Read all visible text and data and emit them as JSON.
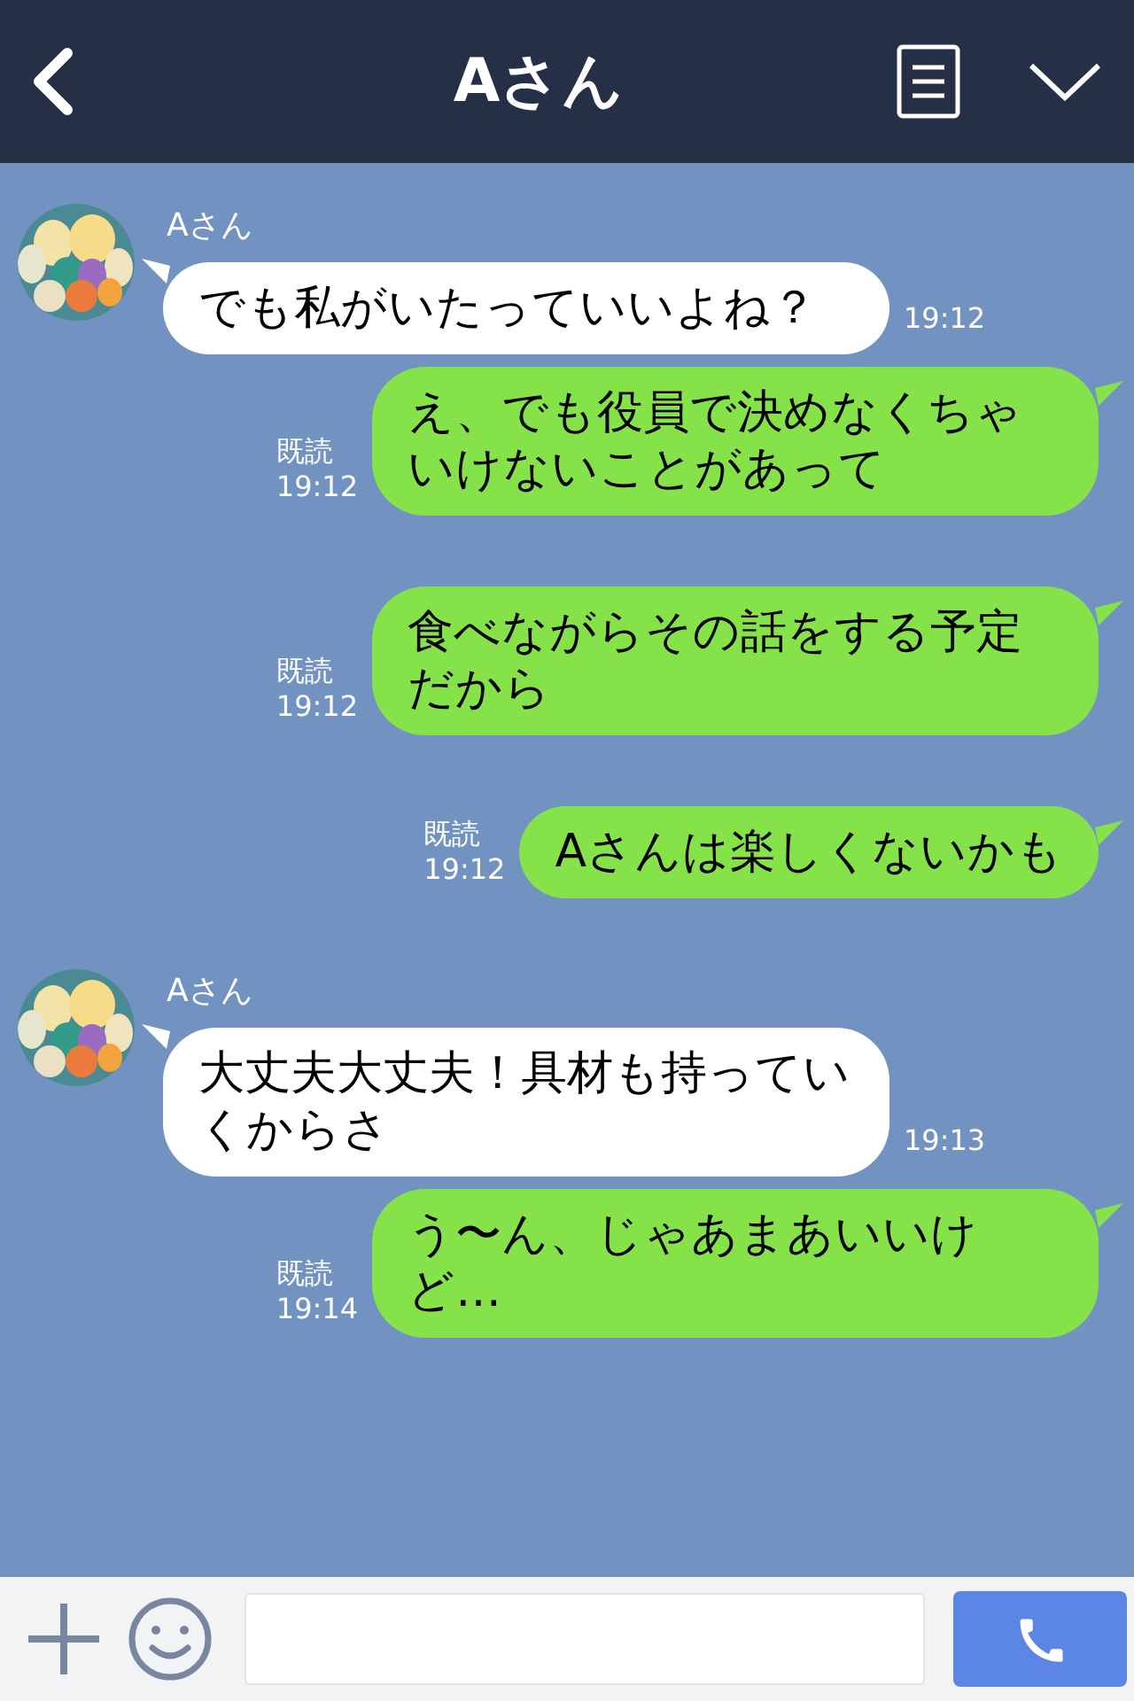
{
  "header": {
    "title": "Aさん"
  },
  "messages": [
    {
      "kind": "received",
      "sender": "Aさん",
      "text": "でも私がいたっていいよね？",
      "time": "19:12"
    },
    {
      "kind": "sent",
      "read": "既読",
      "text": "え、でも役員で決めなくちゃいけないことがあって",
      "time": "19:12"
    },
    {
      "kind": "sent",
      "read": "既読",
      "text": "食べながらその話をする予定だから",
      "time": "19:12"
    },
    {
      "kind": "sent",
      "read": "既読",
      "text": "Aさんは楽しくないかも",
      "time": "19:12"
    },
    {
      "kind": "received",
      "sender": "Aさん",
      "text": "大丈夫大丈夫！具材も持っていくからさ",
      "time": "19:13"
    },
    {
      "kind": "sent",
      "read": "既読",
      "text": "う〜ん、じゃあまあいいけど…",
      "time": "19:14"
    }
  ]
}
